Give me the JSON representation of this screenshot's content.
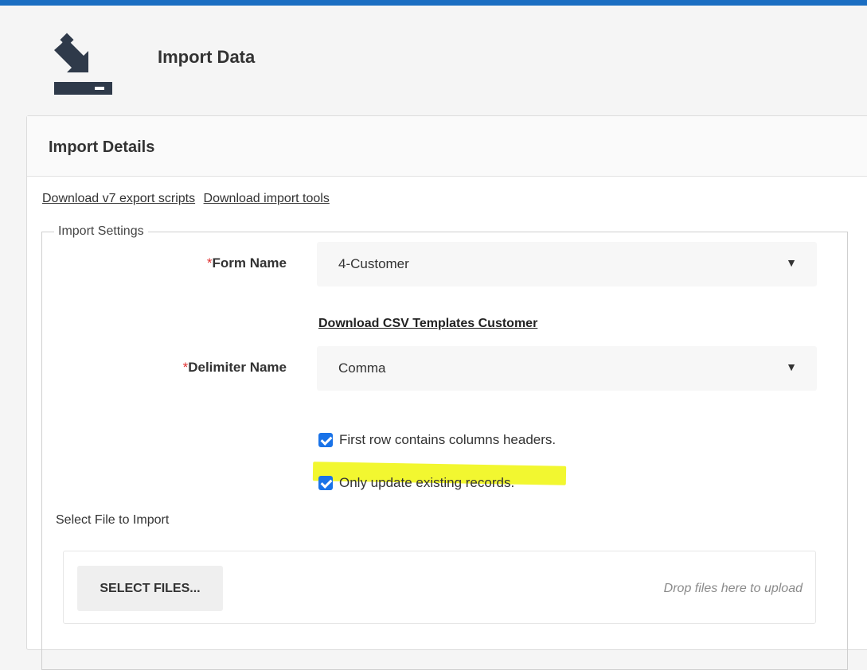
{
  "header": {
    "title": "Import Data",
    "icon": "import-icon"
  },
  "card": {
    "title": "Import Details"
  },
  "links": [
    {
      "label": "Download v7 export scripts"
    },
    {
      "label": "Download import tools"
    }
  ],
  "settings": {
    "legend": "Import Settings",
    "form_name": {
      "label": "Form Name",
      "required_mark": "*",
      "value": "4-Customer"
    },
    "csv_link": "Download CSV Templates Customer",
    "delimiter": {
      "label": "Delimiter Name",
      "required_mark": "*",
      "value": "Comma"
    },
    "checkboxes": [
      {
        "label": "First row contains columns headers.",
        "checked": true
      },
      {
        "label": "Only update existing records.",
        "checked": true,
        "highlighted": true
      }
    ]
  },
  "upload": {
    "label": "Select File to Import",
    "button": "SELECT FILES...",
    "drop_hint": "Drop files here to upload"
  },
  "colors": {
    "accent": "#1b6ec2",
    "checkbox": "#1a73e8",
    "highlight": "#f2f730",
    "required": "#e03030"
  }
}
